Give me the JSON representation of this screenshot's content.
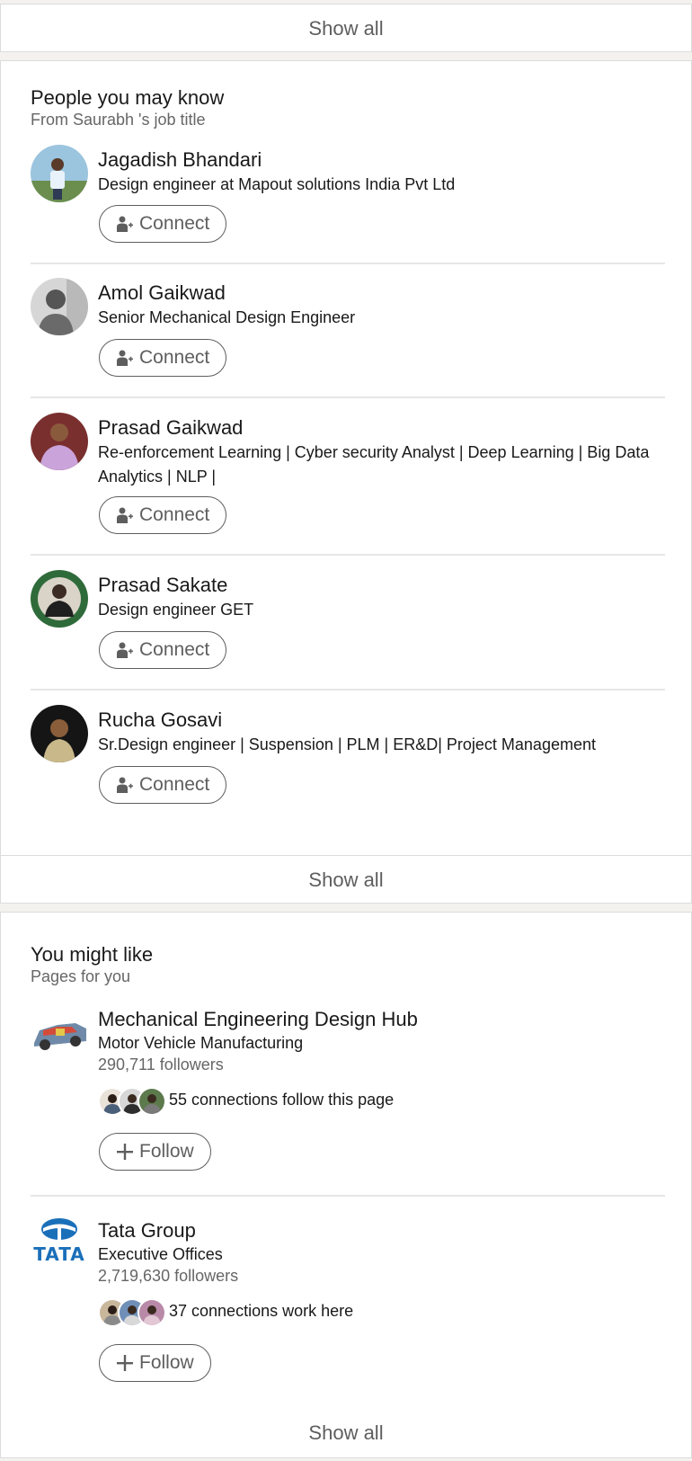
{
  "top_card": {
    "show_all": "Show all"
  },
  "people": {
    "title": "People you may know",
    "subtitle": "From Saurabh 's job title",
    "connect_label": "Connect",
    "show_all": "Show all",
    "items": [
      {
        "name": "Jagadish Bhandari",
        "headline": "Design engineer at Mapout solutions India Pvt Ltd"
      },
      {
        "name": "Amol Gaikwad",
        "headline": "Senior Mechanical Design Engineer"
      },
      {
        "name": "Prasad Gaikwad",
        "headline": "Re-enforcement Learning | Cyber security Analyst | Deep Learning | Big Data Analytics | NLP |"
      },
      {
        "name": "Prasad Sakate",
        "headline": "Design engineer GET"
      },
      {
        "name": "Rucha Gosavi",
        "headline": "Sr.Design engineer | Suspension | PLM | ER&D| Project Management"
      }
    ]
  },
  "pages": {
    "title": "You might like",
    "subtitle": "Pages for you",
    "follow_label": "Follow",
    "show_all": "Show all",
    "items": [
      {
        "name": "Mechanical Engineering Design Hub",
        "industry": "Motor Vehicle Manufacturing",
        "followers": "290,711 followers",
        "connections": "55 connections follow this page"
      },
      {
        "name": "Tata Group",
        "industry": "Executive Offices",
        "followers": "2,719,630 followers",
        "connections": "37 connections work here",
        "logo_text": "TATA"
      }
    ]
  },
  "colors": {
    "text": "#191919",
    "secondary": "#666666",
    "button": "#5e5e5e",
    "tata_blue": "#1a6fb9"
  },
  "icons": {
    "connect": "person-add-icon",
    "follow": "plus-icon"
  }
}
